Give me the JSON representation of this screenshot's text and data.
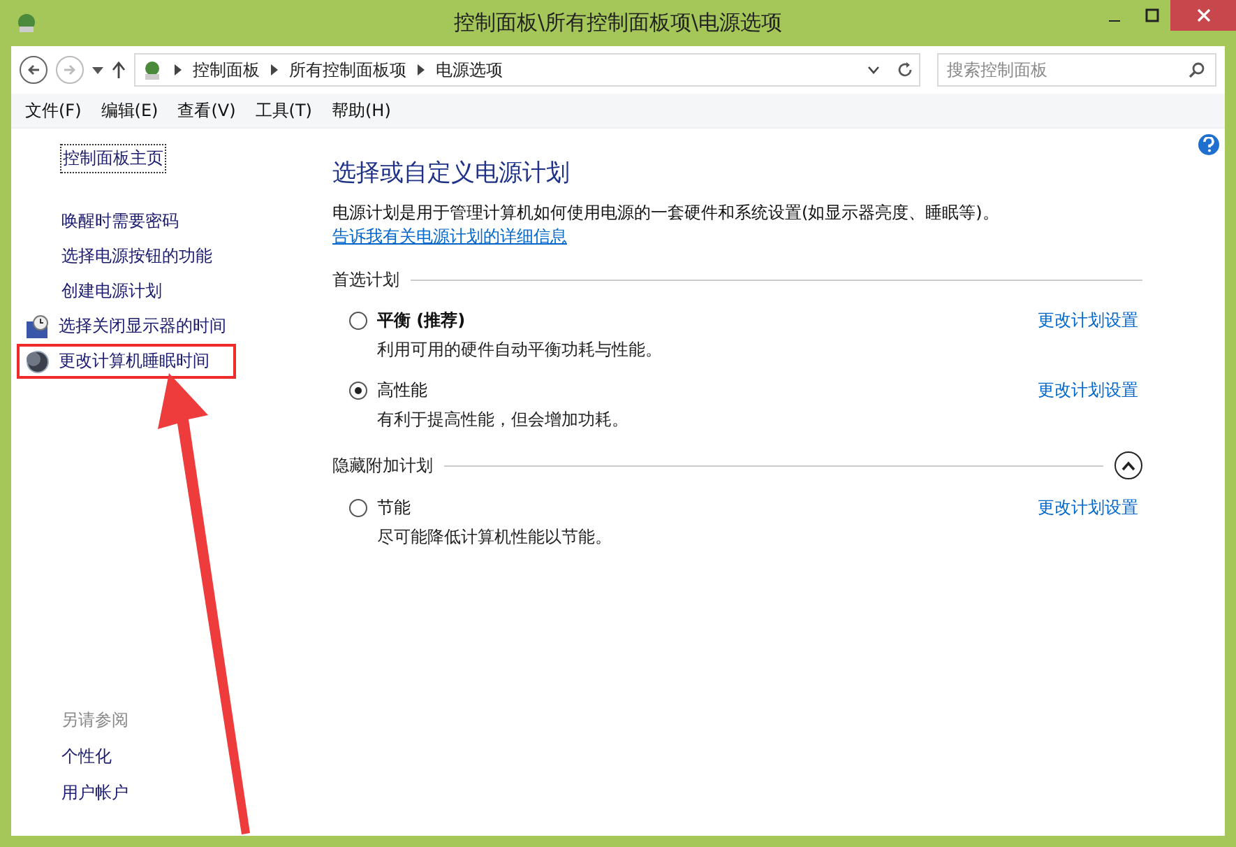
{
  "window": {
    "title": "控制面板\\所有控制面板项\\电源选项"
  },
  "address": {
    "crumbs": [
      "控制面板",
      "所有控制面板项",
      "电源选项"
    ]
  },
  "search": {
    "placeholder": "搜索控制面板"
  },
  "menu": [
    "文件(F)",
    "编辑(E)",
    "查看(V)",
    "工具(T)",
    "帮助(H)"
  ],
  "sidebar": {
    "home": "控制面板主页",
    "links": [
      {
        "label": "唤醒时需要密码",
        "kind": "plain",
        "highlighted": false
      },
      {
        "label": "选择电源按钮的功能",
        "kind": "plain",
        "highlighted": false
      },
      {
        "label": "创建电源计划",
        "kind": "plain",
        "highlighted": false
      },
      {
        "label": "选择关闭显示器的时间",
        "kind": "monitor",
        "highlighted": false
      },
      {
        "label": "更改计算机睡眠时间",
        "kind": "moon",
        "highlighted": true
      }
    ],
    "see_also": {
      "title": "另请参阅",
      "links": [
        "个性化",
        "用户帐户"
      ]
    }
  },
  "main": {
    "title": "选择或自定义电源计划",
    "description": "电源计划是用于管理计算机如何使用电源的一套硬件和系统设置(如显示器亮度、睡眠等)。",
    "description_link": "告诉我有关电源计划的详细信息",
    "groups": [
      {
        "title": "首选计划",
        "collapsible": false,
        "plans": [
          {
            "name": "平衡 (推荐)",
            "recommended": true,
            "selected": false,
            "description": "利用可用的硬件自动平衡功耗与性能。",
            "link": "更改计划设置"
          },
          {
            "name": "高性能",
            "recommended": false,
            "selected": true,
            "description": "有利于提高性能，但会增加功耗。",
            "link": "更改计划设置"
          }
        ]
      },
      {
        "title": "隐藏附加计划",
        "collapsible": true,
        "expanded": true,
        "plans": [
          {
            "name": "节能",
            "recommended": false,
            "selected": false,
            "description": "尽可能降低计算机性能以节能。",
            "link": "更改计划设置"
          }
        ]
      }
    ]
  }
}
